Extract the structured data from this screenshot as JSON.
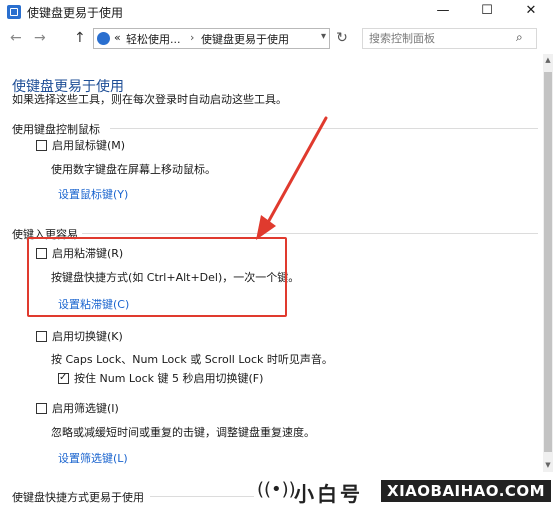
{
  "window": {
    "title": "使键盘更易于使用",
    "minimize": "—",
    "maximize": "☐",
    "close": "✕"
  },
  "address_bar": {
    "back": "←",
    "forward": "→",
    "up": "↑",
    "overflow": "«",
    "crumb1": "轻松使用...",
    "crumb_sep": "›",
    "crumb2": "使键盘更易于使用",
    "dropdown": "▾",
    "refresh": "↻"
  },
  "search": {
    "placeholder": "搜索控制面板",
    "icon": "search-icon",
    "icon_glyph": "⌕"
  },
  "page": {
    "heading": "使键盘更易于使用",
    "description": "如果选择这些工具，则在每次登录时自动启动这些工具。"
  },
  "mouse_section": {
    "title": "使用键盘控制鼠标",
    "mouse_keys": {
      "label": "启用鼠标键(M)",
      "checked": false,
      "note": "使用数字键盘在屏幕上移动鼠标。",
      "link": "设置鼠标键(Y)"
    }
  },
  "typing_section": {
    "title": "使键入更容易",
    "sticky_keys": {
      "label": "启用粘滞键(R)",
      "checked": false,
      "note": "按键盘快捷方式(如 Ctrl+Alt+Del)，一次一个键。",
      "link": "设置粘滞键(C)"
    },
    "toggle_keys": {
      "label": "启用切换键(K)",
      "checked": false,
      "note": "按 Caps Lock、Num Lock 或 Scroll Lock 时听见声音。",
      "sub_option": {
        "label": "按住 Num Lock 键 5 秒启用切换键(F)",
        "checked": true
      }
    },
    "filter_keys": {
      "label": "启用筛选键(I)",
      "checked": false,
      "note": "忽略或减缓短时间或重复的击键，调整键盘重复速度。",
      "link": "设置筛选键(L)"
    }
  },
  "shortcut_section": {
    "title": "使键盘快捷方式更易于使用"
  },
  "scrollbar": {
    "up": "▲",
    "down": "▼"
  },
  "watermark": {
    "icon": "((•))",
    "chinese": "小白号",
    "english": "XIAOBAIHAO.COM"
  },
  "colors": {
    "heading": "#1e4e96",
    "link": "#1a64cf",
    "highlight_box": "#e03a2e",
    "arrow": "#e03a2e"
  }
}
